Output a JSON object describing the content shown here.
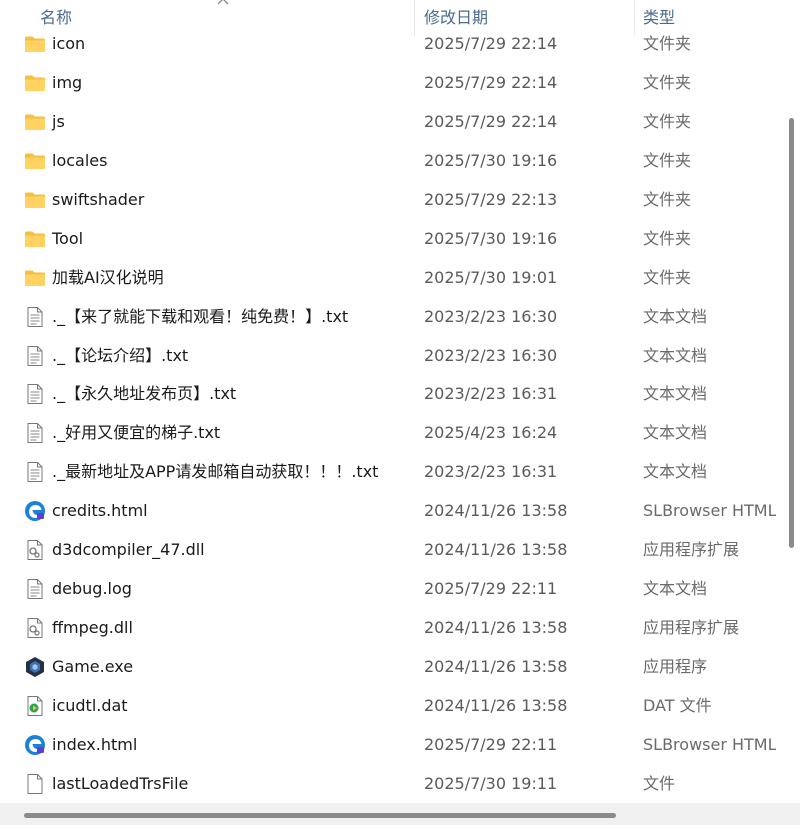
{
  "header": {
    "name_label": "名称",
    "date_label": "修改日期",
    "type_label": "类型"
  },
  "files": [
    {
      "name": "icon",
      "date": "2025/7/29 22:14",
      "type": "文件夹",
      "icon": "folder-icon"
    },
    {
      "name": "img",
      "date": "2025/7/29 22:14",
      "type": "文件夹",
      "icon": "folder-icon"
    },
    {
      "name": "js",
      "date": "2025/7/29 22:14",
      "type": "文件夹",
      "icon": "folder-icon"
    },
    {
      "name": "locales",
      "date": "2025/7/30 19:16",
      "type": "文件夹",
      "icon": "folder-icon"
    },
    {
      "name": "swiftshader",
      "date": "2025/7/29 22:13",
      "type": "文件夹",
      "icon": "folder-icon"
    },
    {
      "name": "Tool",
      "date": "2025/7/30 19:16",
      "type": "文件夹",
      "icon": "folder-icon"
    },
    {
      "name": "加载AI汉化说明",
      "date": "2025/7/30 19:01",
      "type": "文件夹",
      "icon": "folder-icon"
    },
    {
      "name": "._【来了就能下载和观看！纯免费！】.txt",
      "date": "2023/2/23 16:30",
      "type": "文本文档",
      "icon": "text-document-icon"
    },
    {
      "name": "._【论坛介绍】.txt",
      "date": "2023/2/23 16:30",
      "type": "文本文档",
      "icon": "text-document-icon"
    },
    {
      "name": "._【永久地址发布页】.txt",
      "date": "2023/2/23 16:31",
      "type": "文本文档",
      "icon": "text-document-icon"
    },
    {
      "name": "._好用又便宜的梯子.txt",
      "date": "2025/4/23 16:24",
      "type": "文本文档",
      "icon": "text-document-icon"
    },
    {
      "name": "._最新地址及APP请发邮箱自动获取！！！.txt",
      "date": "2023/2/23 16:31",
      "type": "文本文档",
      "icon": "text-document-icon"
    },
    {
      "name": "credits.html",
      "date": "2024/11/26 13:58",
      "type": "SLBrowser HTML",
      "icon": "browser-html-icon"
    },
    {
      "name": "d3dcompiler_47.dll",
      "date": "2024/11/26 13:58",
      "type": "应用程序扩展",
      "icon": "dll-gear-icon"
    },
    {
      "name": "debug.log",
      "date": "2025/7/29 22:11",
      "type": "文本文档",
      "icon": "text-document-icon"
    },
    {
      "name": "ffmpeg.dll",
      "date": "2024/11/26 13:58",
      "type": "应用程序扩展",
      "icon": "dll-gear-icon"
    },
    {
      "name": "Game.exe",
      "date": "2024/11/26 13:58",
      "type": "应用程序",
      "icon": "game-exe-icon"
    },
    {
      "name": "icudtl.dat",
      "date": "2024/11/26 13:58",
      "type": "DAT 文件",
      "icon": "dat-file-icon"
    },
    {
      "name": "index.html",
      "date": "2025/7/29 22:11",
      "type": "SLBrowser HTML",
      "icon": "browser-html-icon"
    },
    {
      "name": "lastLoadedTrsFile",
      "date": "2025/7/30 19:11",
      "type": "文件",
      "icon": "blank-file-icon"
    }
  ],
  "colors": {
    "folder": "#f5c042",
    "header_text": "#4b6b8f",
    "browser_icon": "#1e7fd8",
    "scroll_thumb": "#8a8a8a"
  }
}
